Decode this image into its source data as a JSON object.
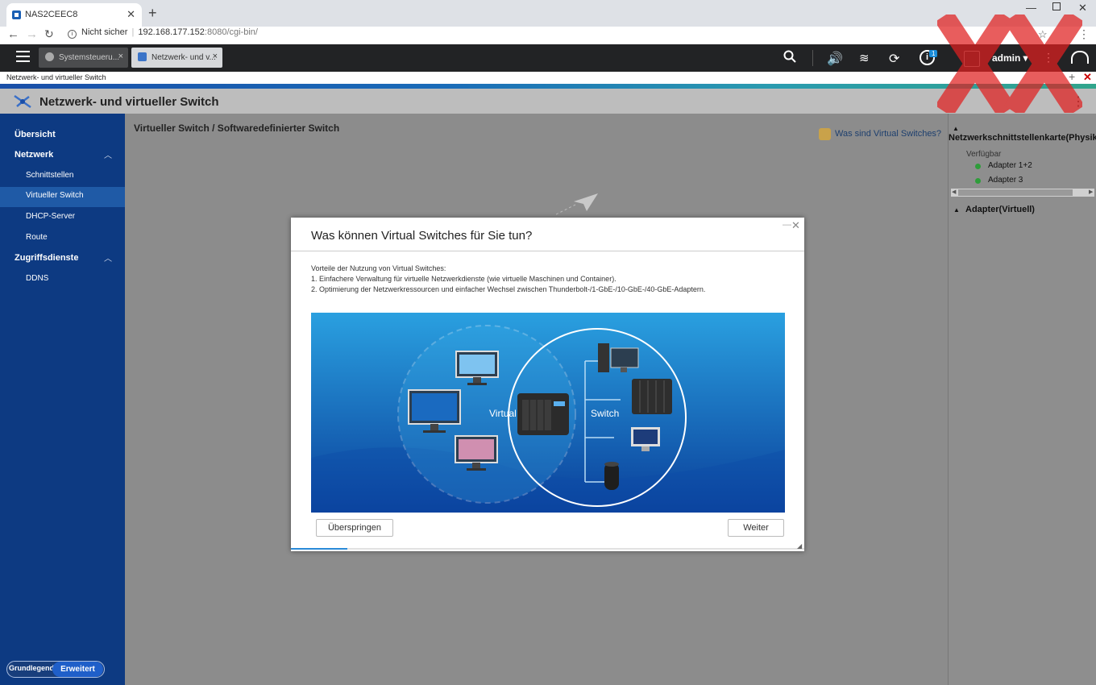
{
  "browser": {
    "tab_title": "NAS2CEEC8",
    "insecure_label": "Nicht sicher",
    "url_host": "192.168.177.152",
    "url_rest": ":8080/cgi-bin/"
  },
  "toolbar": {
    "tabs": [
      {
        "label": "Systemsteueru..."
      },
      {
        "label": "Netzwerk- und v..."
      }
    ],
    "notification_count": "1",
    "user": "admin ▾"
  },
  "window": {
    "crumb": "Netzwerk- und virtueller Switch",
    "title": "Netzwerk- und virtueller Switch"
  },
  "sidebar": {
    "items": [
      {
        "label": "Übersicht"
      },
      {
        "label": "Netzwerk"
      },
      {
        "label": "Schnittstellen"
      },
      {
        "label": "Virtueller Switch"
      },
      {
        "label": "DHCP-Server"
      },
      {
        "label": "Route"
      },
      {
        "label": "Zugriffsdienste"
      },
      {
        "label": "DDNS"
      }
    ],
    "mode_basic": "Grundlegend",
    "mode_advanced": "Erweitert"
  },
  "main": {
    "breadcrumb": "Virtueller Switch / Softwaredefinierter Switch",
    "help_link": "Was sind Virtual Switches?"
  },
  "right_panel": {
    "section1": "Netzwerkschnittstellenkarte(Physikalis",
    "available": "Verfügbar",
    "adapters": [
      "Adapter 1+2",
      "Adapter 3"
    ],
    "section2": "Adapter(Virtuell)"
  },
  "dialog": {
    "title": "Was können Virtual Switches für Sie tun?",
    "intro": "Vorteile der Nutzung von Virtual Switches:",
    "point1": "1. Einfachere Verwaltung für virtuelle Netzwerkdienste (wie virtuelle Maschinen und Container).",
    "point2": "2. Optimierung der Netzwerkressourcen und einfacher Wechsel zwischen Thunderbolt-/1-GbE-/10-GbE-/40-GbE-Adaptern.",
    "illus_virtual": "Virtual",
    "illus_switch": "Switch",
    "skip": "Überspringen",
    "next": "Weiter",
    "progress": 0.11
  },
  "colors": {
    "sidebar": "#0d3a82",
    "sidebar_active": "#1f5aa6",
    "accent": "#1f5fc9"
  }
}
